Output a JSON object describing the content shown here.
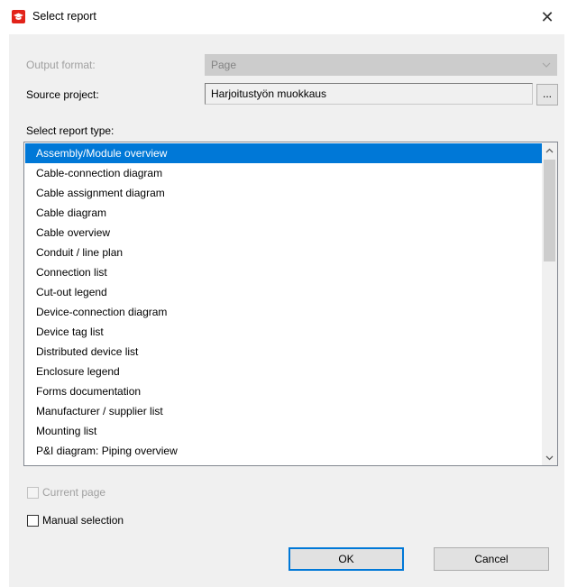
{
  "window": {
    "title": "Select report",
    "close_glyph": "✕"
  },
  "output_format": {
    "label": "Output format:",
    "value": "Page"
  },
  "source_project": {
    "label": "Source project:",
    "value": "Harjoitustyön muokkaus",
    "browse_label": "..."
  },
  "report_type": {
    "label": "Select report type:",
    "selected_index": 0,
    "items": [
      "Assembly/Module overview",
      "Cable-connection diagram",
      "Cable assignment diagram",
      "Cable diagram",
      "Cable overview",
      "Conduit / line plan",
      "Connection list",
      "Cut-out legend",
      "Device-connection diagram",
      "Device tag list",
      "Distributed device list",
      "Enclosure legend",
      "Forms documentation",
      "Manufacturer / supplier list",
      "Mounting list",
      "P&I diagram: Piping overview"
    ]
  },
  "options": {
    "current_page": {
      "label": "Current page",
      "checked": false,
      "enabled": false
    },
    "manual_selection": {
      "label": "Manual selection",
      "checked": false,
      "enabled": true
    }
  },
  "buttons": {
    "ok": "OK",
    "cancel": "Cancel"
  },
  "colors": {
    "selection": "#0078d7",
    "app_icon": "#e2231a"
  },
  "icons": {
    "app": "graduation-cap-icon",
    "dropdown": "chevron-down-icon",
    "scroll_up": "arrow-up-icon",
    "scroll_down": "arrow-down-icon"
  }
}
